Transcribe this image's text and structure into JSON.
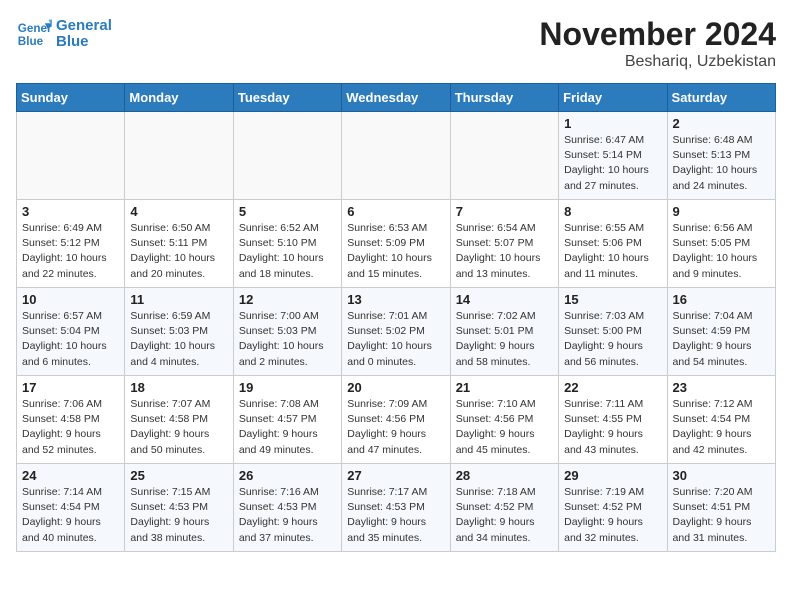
{
  "logo": {
    "line1": "General",
    "line2": "Blue"
  },
  "title": "November 2024",
  "location": "Beshariq, Uzbekistan",
  "weekdays": [
    "Sunday",
    "Monday",
    "Tuesday",
    "Wednesday",
    "Thursday",
    "Friday",
    "Saturday"
  ],
  "weeks": [
    [
      {
        "day": "",
        "info": ""
      },
      {
        "day": "",
        "info": ""
      },
      {
        "day": "",
        "info": ""
      },
      {
        "day": "",
        "info": ""
      },
      {
        "day": "",
        "info": ""
      },
      {
        "day": "1",
        "info": "Sunrise: 6:47 AM\nSunset: 5:14 PM\nDaylight: 10 hours\nand 27 minutes."
      },
      {
        "day": "2",
        "info": "Sunrise: 6:48 AM\nSunset: 5:13 PM\nDaylight: 10 hours\nand 24 minutes."
      }
    ],
    [
      {
        "day": "3",
        "info": "Sunrise: 6:49 AM\nSunset: 5:12 PM\nDaylight: 10 hours\nand 22 minutes."
      },
      {
        "day": "4",
        "info": "Sunrise: 6:50 AM\nSunset: 5:11 PM\nDaylight: 10 hours\nand 20 minutes."
      },
      {
        "day": "5",
        "info": "Sunrise: 6:52 AM\nSunset: 5:10 PM\nDaylight: 10 hours\nand 18 minutes."
      },
      {
        "day": "6",
        "info": "Sunrise: 6:53 AM\nSunset: 5:09 PM\nDaylight: 10 hours\nand 15 minutes."
      },
      {
        "day": "7",
        "info": "Sunrise: 6:54 AM\nSunset: 5:07 PM\nDaylight: 10 hours\nand 13 minutes."
      },
      {
        "day": "8",
        "info": "Sunrise: 6:55 AM\nSunset: 5:06 PM\nDaylight: 10 hours\nand 11 minutes."
      },
      {
        "day": "9",
        "info": "Sunrise: 6:56 AM\nSunset: 5:05 PM\nDaylight: 10 hours\nand 9 minutes."
      }
    ],
    [
      {
        "day": "10",
        "info": "Sunrise: 6:57 AM\nSunset: 5:04 PM\nDaylight: 10 hours\nand 6 minutes."
      },
      {
        "day": "11",
        "info": "Sunrise: 6:59 AM\nSunset: 5:03 PM\nDaylight: 10 hours\nand 4 minutes."
      },
      {
        "day": "12",
        "info": "Sunrise: 7:00 AM\nSunset: 5:03 PM\nDaylight: 10 hours\nand 2 minutes."
      },
      {
        "day": "13",
        "info": "Sunrise: 7:01 AM\nSunset: 5:02 PM\nDaylight: 10 hours\nand 0 minutes."
      },
      {
        "day": "14",
        "info": "Sunrise: 7:02 AM\nSunset: 5:01 PM\nDaylight: 9 hours\nand 58 minutes."
      },
      {
        "day": "15",
        "info": "Sunrise: 7:03 AM\nSunset: 5:00 PM\nDaylight: 9 hours\nand 56 minutes."
      },
      {
        "day": "16",
        "info": "Sunrise: 7:04 AM\nSunset: 4:59 PM\nDaylight: 9 hours\nand 54 minutes."
      }
    ],
    [
      {
        "day": "17",
        "info": "Sunrise: 7:06 AM\nSunset: 4:58 PM\nDaylight: 9 hours\nand 52 minutes."
      },
      {
        "day": "18",
        "info": "Sunrise: 7:07 AM\nSunset: 4:58 PM\nDaylight: 9 hours\nand 50 minutes."
      },
      {
        "day": "19",
        "info": "Sunrise: 7:08 AM\nSunset: 4:57 PM\nDaylight: 9 hours\nand 49 minutes."
      },
      {
        "day": "20",
        "info": "Sunrise: 7:09 AM\nSunset: 4:56 PM\nDaylight: 9 hours\nand 47 minutes."
      },
      {
        "day": "21",
        "info": "Sunrise: 7:10 AM\nSunset: 4:56 PM\nDaylight: 9 hours\nand 45 minutes."
      },
      {
        "day": "22",
        "info": "Sunrise: 7:11 AM\nSunset: 4:55 PM\nDaylight: 9 hours\nand 43 minutes."
      },
      {
        "day": "23",
        "info": "Sunrise: 7:12 AM\nSunset: 4:54 PM\nDaylight: 9 hours\nand 42 minutes."
      }
    ],
    [
      {
        "day": "24",
        "info": "Sunrise: 7:14 AM\nSunset: 4:54 PM\nDaylight: 9 hours\nand 40 minutes."
      },
      {
        "day": "25",
        "info": "Sunrise: 7:15 AM\nSunset: 4:53 PM\nDaylight: 9 hours\nand 38 minutes."
      },
      {
        "day": "26",
        "info": "Sunrise: 7:16 AM\nSunset: 4:53 PM\nDaylight: 9 hours\nand 37 minutes."
      },
      {
        "day": "27",
        "info": "Sunrise: 7:17 AM\nSunset: 4:53 PM\nDaylight: 9 hours\nand 35 minutes."
      },
      {
        "day": "28",
        "info": "Sunrise: 7:18 AM\nSunset: 4:52 PM\nDaylight: 9 hours\nand 34 minutes."
      },
      {
        "day": "29",
        "info": "Sunrise: 7:19 AM\nSunset: 4:52 PM\nDaylight: 9 hours\nand 32 minutes."
      },
      {
        "day": "30",
        "info": "Sunrise: 7:20 AM\nSunset: 4:51 PM\nDaylight: 9 hours\nand 31 minutes."
      }
    ]
  ]
}
